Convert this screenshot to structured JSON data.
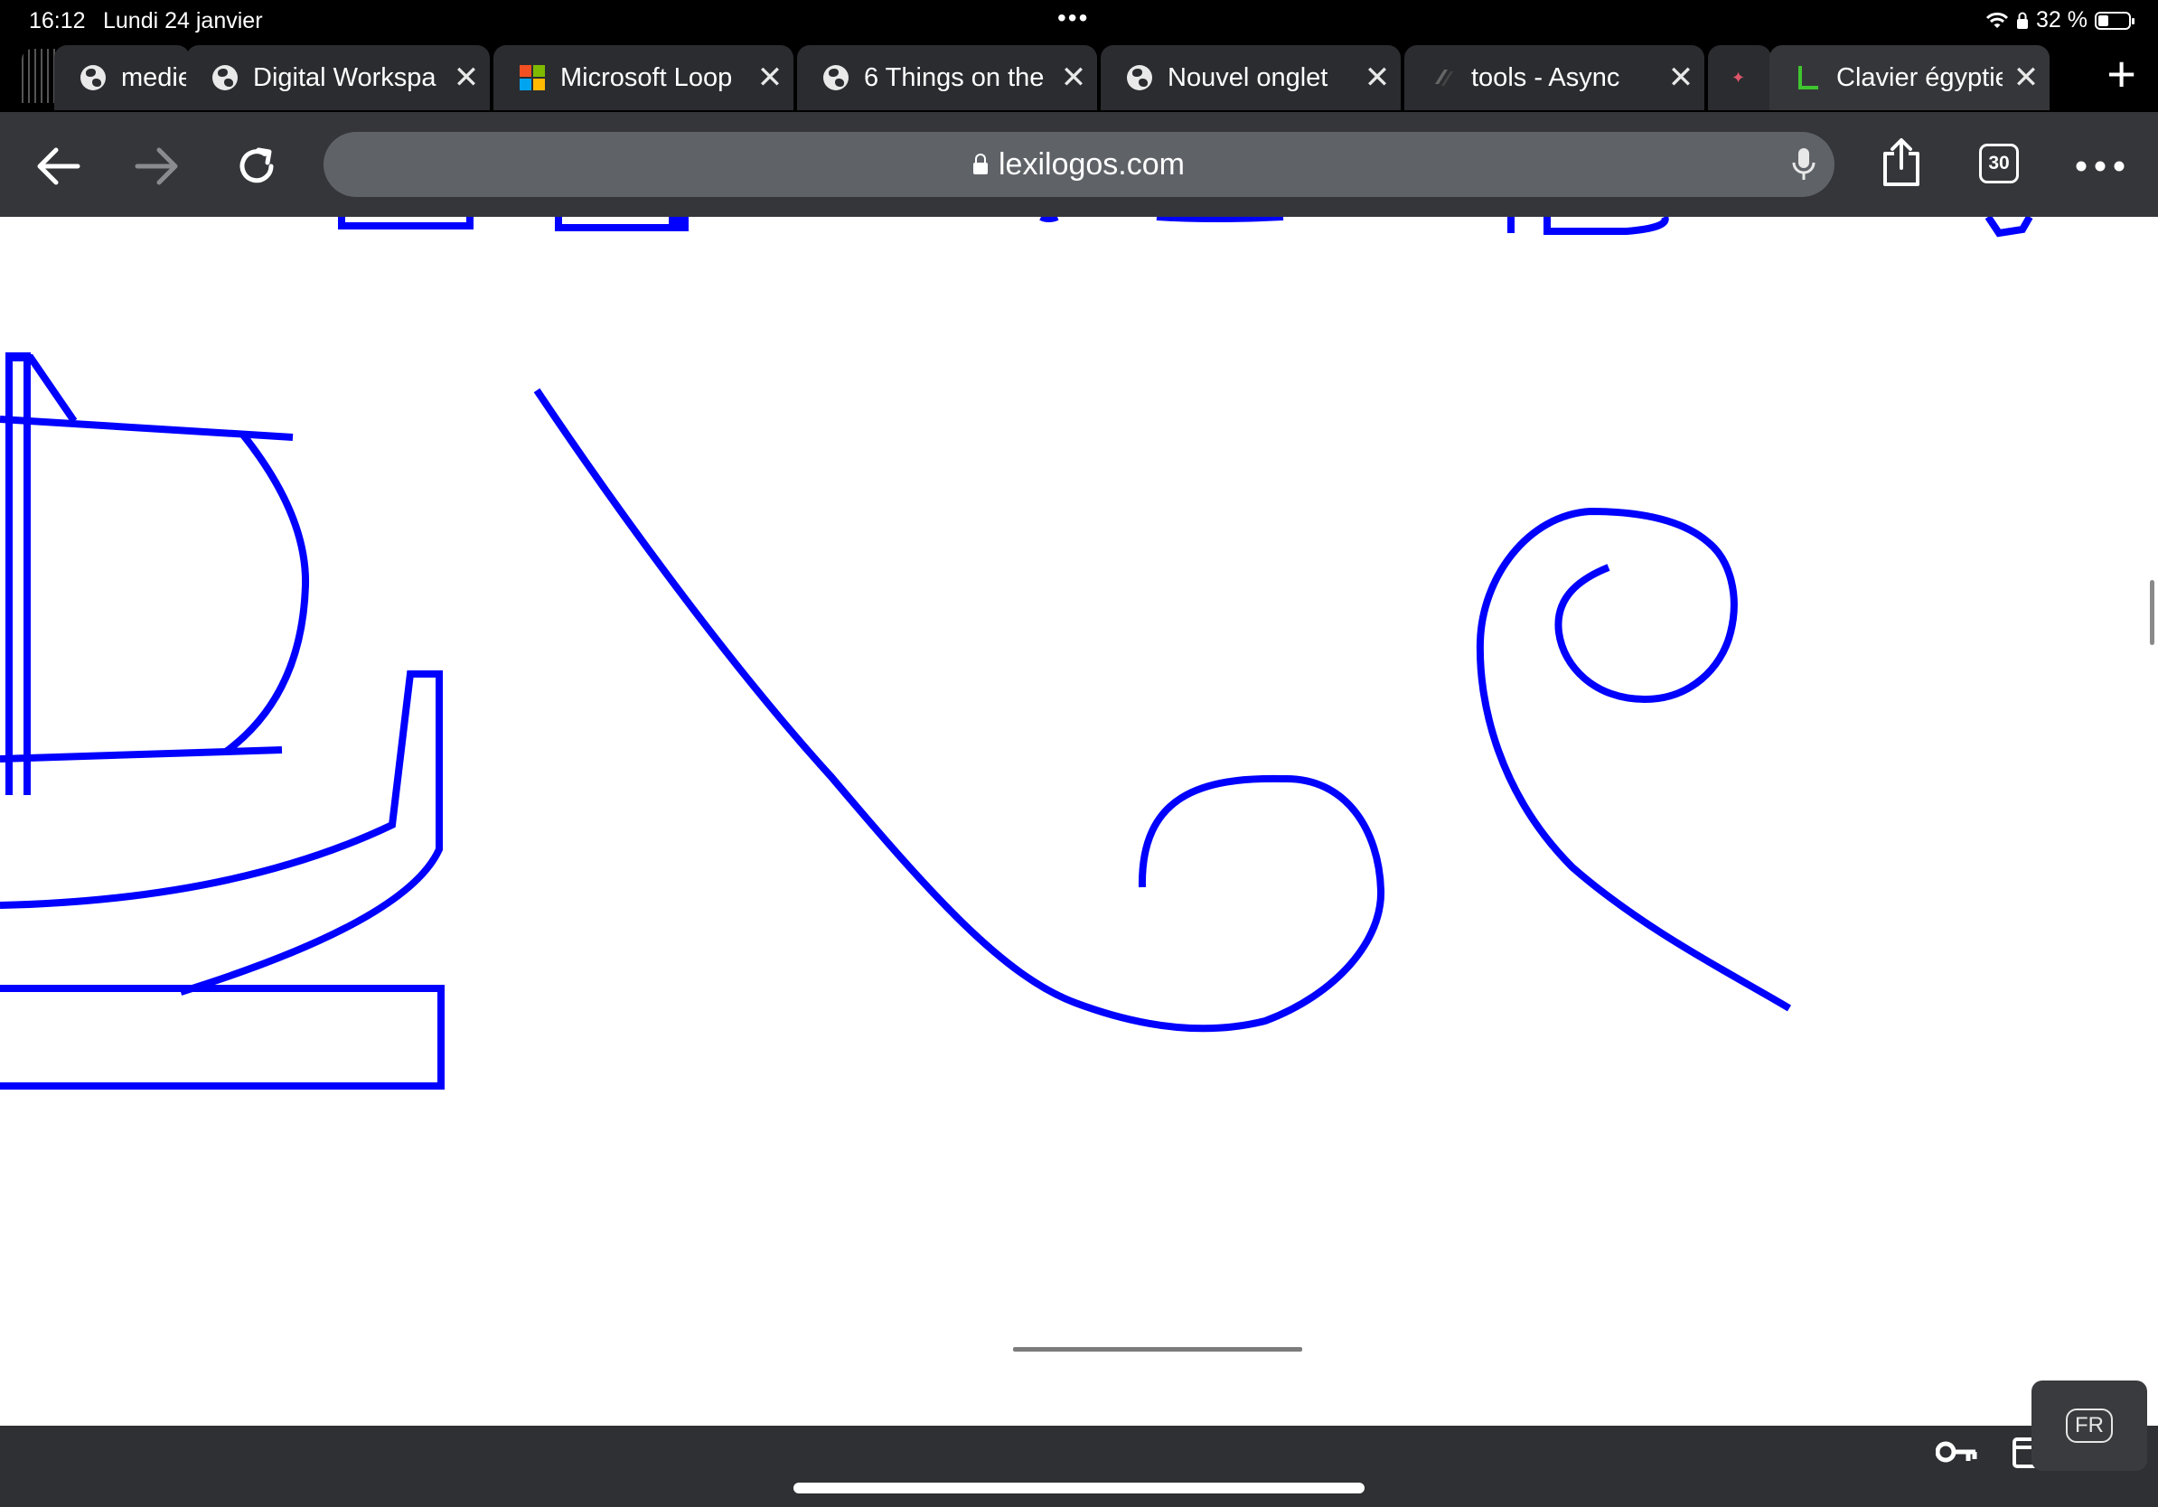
{
  "status_bar": {
    "time": "16:12",
    "date": "Lundi 24 janvier",
    "battery": "32 %"
  },
  "tabs": [
    {
      "label": "medie",
      "icon": "globe-icon"
    },
    {
      "label": "Digital Workspa",
      "icon": "globe-icon"
    },
    {
      "label": "Microsoft Loop",
      "icon": "microsoft-icon"
    },
    {
      "label": "6 Things on the",
      "icon": "globe-icon"
    },
    {
      "label": "Nouvel onglet",
      "icon": "globe-icon"
    },
    {
      "label": "tools - Async",
      "icon": "async-icon"
    },
    {
      "label": "Clavier égyptie",
      "icon": "lexilogos-icon"
    }
  ],
  "toolbar": {
    "url": "lexilogos.com",
    "tab_count": "30"
  },
  "keyboard": {
    "language": "FR"
  },
  "colors": {
    "glyph_stroke": "#0000ff",
    "tab_bg": "#2b2c30",
    "toolbar_bg": "#35363a",
    "omnibox_bg": "#5f6368"
  }
}
